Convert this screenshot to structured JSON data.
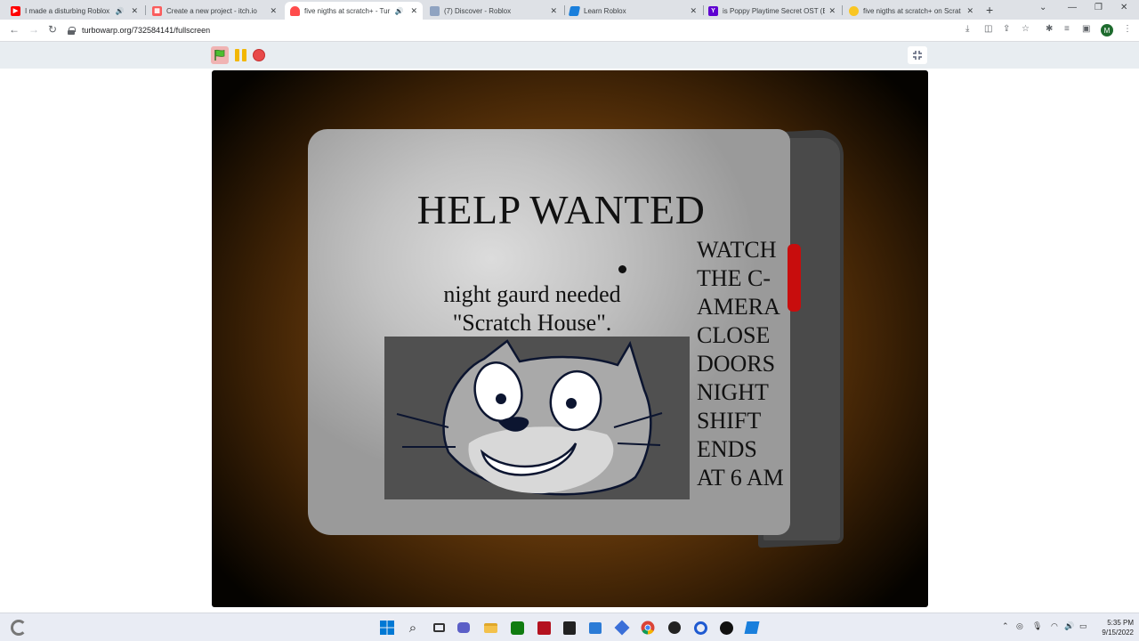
{
  "tabs": [
    {
      "title": "I made a disturbing Roblox",
      "favicon": "youtube-icon",
      "color": "#ff0000",
      "audio": true
    },
    {
      "title": "Create a new project - itch.io",
      "favicon": "itch-icon",
      "color": "#fa5c5c",
      "audio": false
    },
    {
      "title": "five nigths at scratch+ - Tur",
      "favicon": "turbowarp-icon",
      "color": "#ff4c4c",
      "audio": true,
      "active": true
    },
    {
      "title": "(7) Discover - Roblox",
      "favicon": "roblox-icon",
      "color": "#8fa3c1",
      "audio": false
    },
    {
      "title": "Learn Roblox",
      "favicon": "roblox-studio-icon",
      "color": "#1a7fdc",
      "audio": false
    },
    {
      "title": "is Poppy Playtime Secret OST (E",
      "favicon": "yahoo-icon",
      "color": "#5f01d1",
      "audio": false
    },
    {
      "title": "five nigths at scratch+ on Scrat",
      "favicon": "scratch-icon",
      "color": "#f9c623",
      "audio": false
    }
  ],
  "address": {
    "url": "turbowarp.org/732584141/fullscreen"
  },
  "profile": {
    "initial": "M"
  },
  "stage": {
    "headline": "HELP WANTED",
    "line1": "night gaurd needed",
    "line2": "\"Scratch House\".",
    "rules": [
      "WATCH",
      "THE C-",
      "AMERA",
      "CLOSE",
      "DOORS",
      "NIGHT",
      "SHIFT",
      "ENDS",
      "AT 6 AM"
    ]
  },
  "clock": {
    "time": "5:35 PM",
    "date": "9/15/2022"
  }
}
